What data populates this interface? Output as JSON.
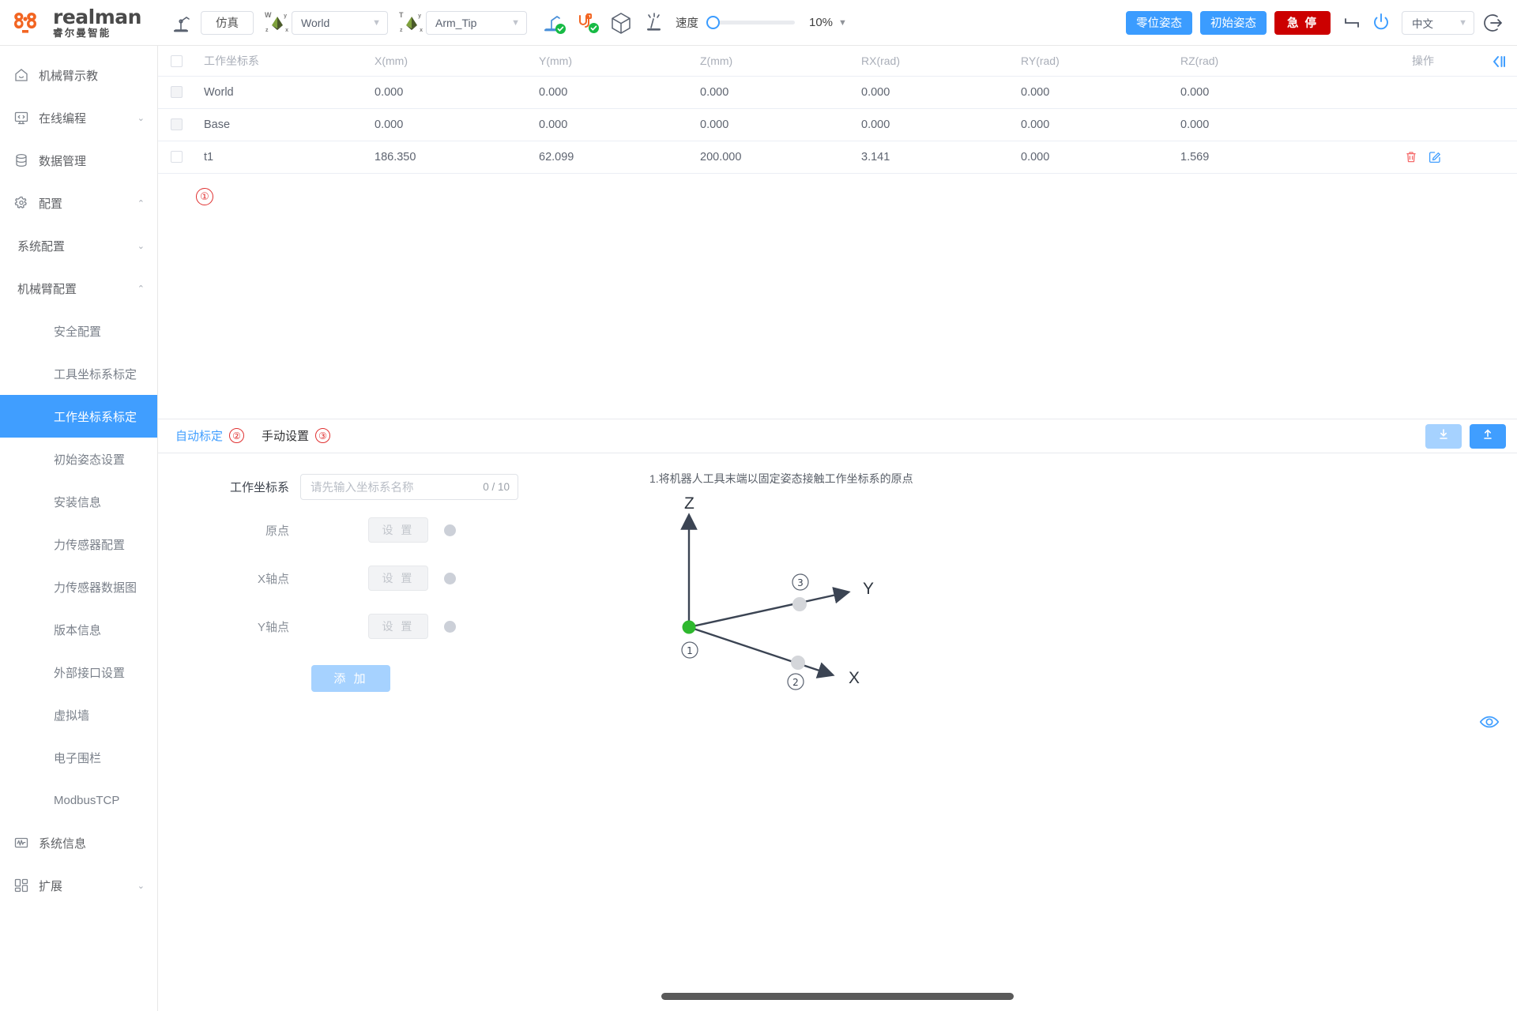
{
  "topbar": {
    "brand_en": "realman",
    "brand_cn": "睿尔曼智能",
    "robot_icon": "robot-arm-icon",
    "sim_button": "仿真",
    "world_axis_icon": "world-axis-icon",
    "world_select_value": "World",
    "tool_axis_icon": "tool-axis-icon",
    "tool_select_value": "Arm_Tip",
    "status_arm_icon": "arm-connected-icon",
    "status_io_icon": "io-connected-icon",
    "cube_icon": "collision-cube-icon",
    "drag_icon": "drag-teach-icon",
    "speed_label": "速度",
    "speed_value": "10%",
    "zero_pose_button": "零位姿态",
    "init_pose_button": "初始姿态",
    "estop_button": "急 停",
    "joint_icon": "joint-limit-icon",
    "power_icon": "power-icon",
    "language_value": "中文",
    "logout_icon": "logout-icon",
    "accent_blue": "#3b9cff",
    "estop_red": "#cc0000",
    "brand_orange": "#f26522"
  },
  "sidebar": {
    "items": [
      {
        "label": "机械臂示教",
        "icon": "home-icon",
        "type": "item",
        "chevron": ""
      },
      {
        "label": "在线编程",
        "icon": "code-icon",
        "type": "item",
        "chevron": "down"
      },
      {
        "label": "数据管理",
        "icon": "database-icon",
        "type": "item",
        "chevron": ""
      },
      {
        "label": "配置",
        "icon": "gear-icon",
        "type": "item",
        "chevron": "up"
      },
      {
        "label": "系统配置",
        "icon": "",
        "type": "sub",
        "chevron": "down"
      },
      {
        "label": "机械臂配置",
        "icon": "",
        "type": "sub",
        "chevron": "up"
      },
      {
        "label": "安全配置",
        "icon": "",
        "type": "leaf",
        "chevron": ""
      },
      {
        "label": "工具坐标系标定",
        "icon": "",
        "type": "leaf",
        "chevron": ""
      },
      {
        "label": "工作坐标系标定",
        "icon": "",
        "type": "leaf",
        "chevron": "",
        "active": true
      },
      {
        "label": "初始姿态设置",
        "icon": "",
        "type": "leaf",
        "chevron": ""
      },
      {
        "label": "安装信息",
        "icon": "",
        "type": "leaf",
        "chevron": ""
      },
      {
        "label": "力传感器配置",
        "icon": "",
        "type": "leaf",
        "chevron": ""
      },
      {
        "label": "力传感器数据图",
        "icon": "",
        "type": "leaf",
        "chevron": ""
      },
      {
        "label": "版本信息",
        "icon": "",
        "type": "leaf",
        "chevron": ""
      },
      {
        "label": "外部接口设置",
        "icon": "",
        "type": "leaf",
        "chevron": ""
      },
      {
        "label": "虚拟墙",
        "icon": "",
        "type": "leaf",
        "chevron": ""
      },
      {
        "label": "电子围栏",
        "icon": "",
        "type": "leaf",
        "chevron": ""
      },
      {
        "label": "ModbusTCP",
        "icon": "",
        "type": "leaf",
        "chevron": ""
      },
      {
        "label": "系统信息",
        "icon": "monitor-wave-icon",
        "type": "item",
        "chevron": ""
      },
      {
        "label": "扩展",
        "icon": "grid-icon",
        "type": "item",
        "chevron": "down"
      }
    ]
  },
  "table": {
    "columns": [
      "工作坐标系",
      "X(mm)",
      "Y(mm)",
      "Z(mm)",
      "RX(rad)",
      "RY(rad)",
      "RZ(rad)",
      "操作"
    ],
    "rows": [
      {
        "name": "World",
        "x": "0.000",
        "y": "0.000",
        "z": "0.000",
        "rx": "0.000",
        "ry": "0.000",
        "rz": "0.000",
        "has_actions": false
      },
      {
        "name": "Base",
        "x": "0.000",
        "y": "0.000",
        "z": "0.000",
        "rx": "0.000",
        "ry": "0.000",
        "rz": "0.000",
        "has_actions": false
      },
      {
        "name": "t1",
        "x": "186.350",
        "y": "62.099",
        "z": "200.000",
        "rx": "3.141",
        "ry": "0.000",
        "rz": "1.569",
        "has_actions": true
      }
    ],
    "delete_icon": "trash-icon",
    "edit_icon": "edit-pencil-icon",
    "collapse_icon": "collapse-panel-icon",
    "annotation_1": "①"
  },
  "tabs": [
    {
      "label": "自动标定",
      "badge": "②",
      "active": true
    },
    {
      "label": "手动设置",
      "badge": "③",
      "active": false
    }
  ],
  "io": {
    "download_icon": "download-icon",
    "upload_icon": "upload-icon"
  },
  "form": {
    "frame_label": "工作坐标系",
    "frame_value": "",
    "frame_placeholder": "请先输入坐标系名称",
    "frame_counter": "0 / 10",
    "rows": [
      {
        "label": "原点",
        "button": "设 置"
      },
      {
        "label": "X轴点",
        "button": "设 置"
      },
      {
        "label": "Y轴点",
        "button": "设 置"
      }
    ],
    "add_button": "添 加"
  },
  "diagram": {
    "hint": "1.将机器人工具末端以固定姿态接触工作坐标系的原点",
    "axis_z": "Z",
    "axis_y": "Y",
    "axis_x": "X",
    "point_origin": "①",
    "point_x": "②",
    "point_y": "③",
    "origin_color": "#2eb82e",
    "axis_color": "#3b4453"
  },
  "footer": {
    "eye_icon": "eye-icon",
    "scrollbar": "horizontal-scrollbar"
  }
}
